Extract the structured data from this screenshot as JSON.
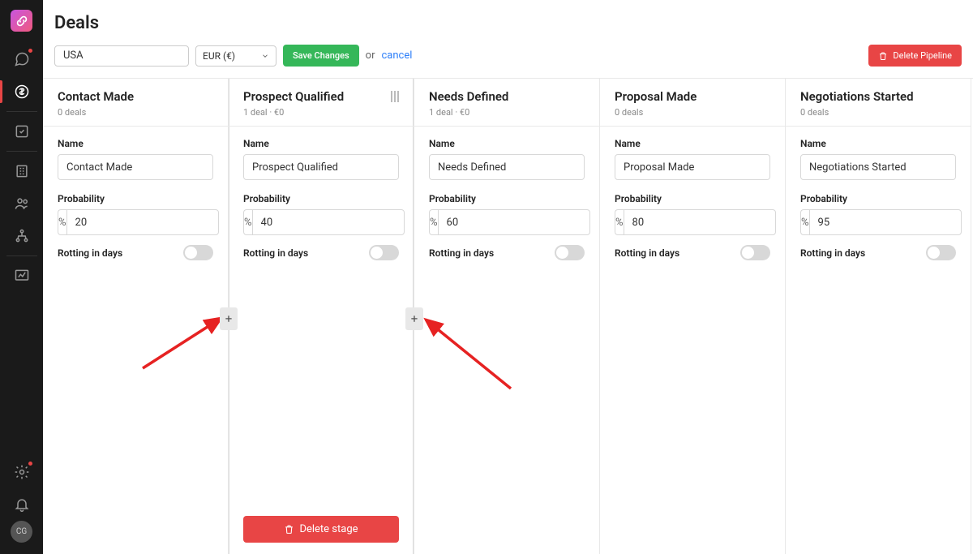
{
  "page_title": "Deals",
  "pipeline_name": "USA",
  "currency": "EUR (€)",
  "save_label": "Save Changes",
  "or_label": "or",
  "cancel_label": "cancel",
  "delete_pipeline_label": "Delete Pipeline",
  "labels": {
    "name": "Name",
    "probability": "Probability",
    "rotting": "Rotting in days",
    "percent": "%"
  },
  "delete_stage_label": "Delete stage",
  "sidebar": {
    "avatar": "CG"
  },
  "columns": [
    {
      "title": "Contact Made",
      "sub": "0 deals",
      "name_val": "Contact Made",
      "prob": "20",
      "selected": false
    },
    {
      "title": "Prospect Qualified",
      "sub": "1 deal · €0",
      "name_val": "Prospect Qualified",
      "prob": "40",
      "selected": true
    },
    {
      "title": "Needs Defined",
      "sub": "1 deal · €0",
      "name_val": "Needs Defined",
      "prob": "60",
      "selected": false
    },
    {
      "title": "Proposal Made",
      "sub": "0 deals",
      "name_val": "Proposal Made",
      "prob": "80",
      "selected": false
    },
    {
      "title": "Negotiations Started",
      "sub": "0 deals",
      "name_val": "Negotiations Started",
      "prob": "95",
      "selected": false
    }
  ]
}
